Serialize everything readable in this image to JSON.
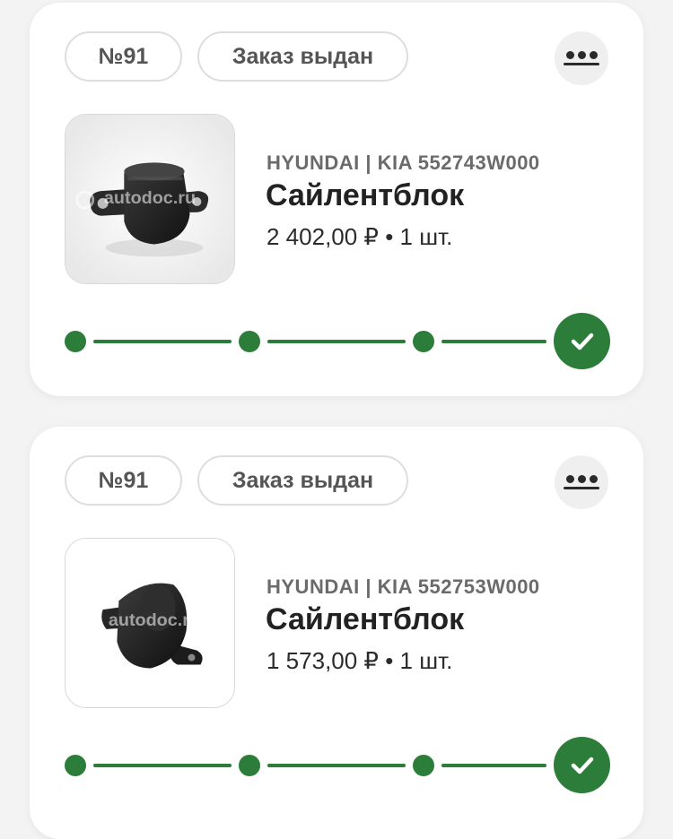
{
  "orders": [
    {
      "number": "№91",
      "status": "Заказ выдан",
      "brand_article": "HYUNDAI | KIA 552743W000",
      "title": "Сайлентблок",
      "price_line": "2 402,00 ₽ • 1 шт.",
      "image_watermark": "autodoc.ru",
      "progress_steps_completed": 4,
      "progress_steps_total": 4
    },
    {
      "number": "№91",
      "status": "Заказ выдан",
      "brand_article": "HYUNDAI | KIA 552753W000",
      "title": "Сайлентблок",
      "price_line": "1 573,00 ₽ • 1 шт.",
      "image_watermark": "autodoc.ru",
      "progress_steps_completed": 4,
      "progress_steps_total": 4
    }
  ],
  "colors": {
    "accent_green": "#2d7d3a",
    "pill_border": "#dedede",
    "muted_text": "#6b6b6b"
  },
  "icons": {
    "more": "more-dots-icon",
    "done": "checkmark-icon"
  }
}
